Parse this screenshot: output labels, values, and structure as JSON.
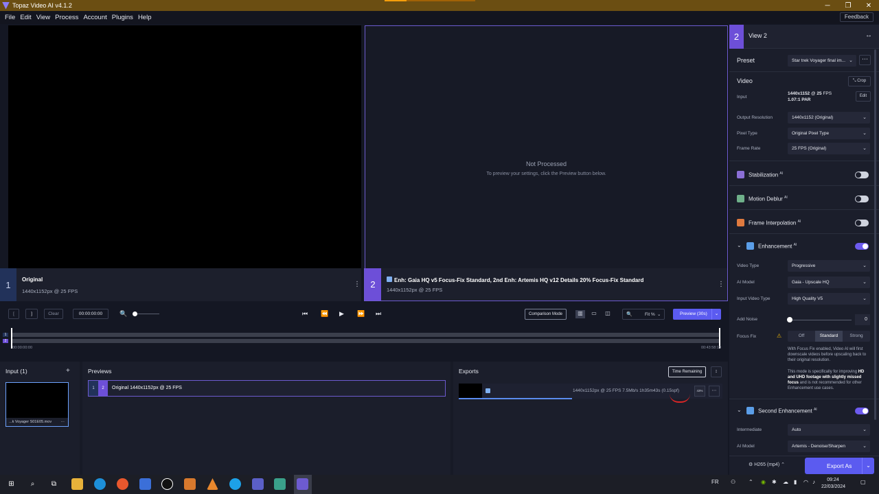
{
  "window": {
    "title": "Topaz Video AI  v4.1.2",
    "controls": [
      "─",
      "❐",
      "✕"
    ]
  },
  "menu": [
    "File",
    "Edit",
    "View",
    "Process",
    "Account",
    "Plugins",
    "Help"
  ],
  "feedback_label": "Feedback",
  "viewer2": {
    "status": "Not Processed",
    "hint": "To preview your settings, click the Preview button below."
  },
  "view1_info": {
    "number": "1",
    "name": "Original",
    "details": "1440x1152px @ 25 FPS"
  },
  "view2_info": {
    "number": "2",
    "name": "Enh: Gaia HQ v5 Focus-Fix Standard, 2nd Enh: Artemis HQ v12 Details 20% Focus-Fix Standard",
    "details": "1440x1152px @ 25 FPS"
  },
  "controls": {
    "in_marker": "[",
    "out_marker": "]",
    "clear_label": "Clear",
    "timecode": "00:00:00:00",
    "comparison_label": "Comparison Mode",
    "zoom_label": "Fit %",
    "preview_label": "Preview (30s)"
  },
  "timeline": {
    "start": "00:00:00:00",
    "end": "00:43:58:19",
    "track_badges": [
      "1",
      "2"
    ]
  },
  "inputs": {
    "title": "Input (1)",
    "add": "+",
    "item_caption": "...k Voyager S01E05.mov",
    "item_menu": "⋯"
  },
  "previews": {
    "title": "Previews",
    "row": {
      "n1": "1",
      "n2": "2",
      "label": "Original   1440x1152px @ 25 FPS"
    }
  },
  "exports": {
    "title": "Exports",
    "time_remaining_label": "Time Remaining",
    "sort_icon": "↕",
    "row_info": "1440x1152px @ 25 FPS  7.5Mb/s     1h35m43s (0.15spf)",
    "percent": "43%",
    "more": "⋯",
    "progress": 0.43
  },
  "sidebar": {
    "view_number": "2",
    "view_title": "View 2",
    "preset_label": "Preset",
    "preset_value": "Star trek Voyager final im...",
    "video_label": "Video",
    "crop_label": "Crop",
    "input_label": "Input",
    "input_res": "1440x1152",
    "input_at": " @ ",
    "input_fps": "25",
    "input_fps_unit": " FPS",
    "input_par": "1.07:1 PAR",
    "edit_label": "Edit",
    "output_res_label": "Output Resolution",
    "output_res_value": "1440x1152 (Original)",
    "pixel_type_label": "Pixel Type",
    "pixel_type_value": "Original Pixel Type",
    "frame_rate_label": "Frame Rate",
    "frame_rate_value": "25 FPS (Original)",
    "stabilization": "Stabilization",
    "motion_deblur": "Motion Deblur",
    "frame_interp": "Frame Interpolation",
    "enhancement": "Enhancement",
    "ai_sup": "AI",
    "video_type_label": "Video Type",
    "video_type_value": "Progressive",
    "ai_model_label": "AI Model",
    "ai_model_value": "Gaia - Upscale HQ",
    "input_video_type_label": "Input Video Type",
    "input_video_type_value": "High Quality V5",
    "add_noise_label": "Add Noise",
    "add_noise_value": "0",
    "focus_fix_label": "Focus Fix",
    "focus_options": [
      "Off",
      "Standard",
      "Strong"
    ],
    "focus_note": "With Focus Fix enabled, Video AI will first downscale videos before upscaling back to their original resolution.",
    "note2_a": "This mode is specifically for improving ",
    "note2_b": "HD and UHD footage with slightly missed focus",
    "note2_c": " and is not recommended for other Enhancement use cases.",
    "second_enh": "Second Enhancement",
    "intermediate_label": "Intermediate",
    "intermediate_value": "Auto",
    "ai_model2_label": "AI Model",
    "ai_model2_value": "Artemis - Denoise/Sharpen",
    "codec": "H265 (mp4)",
    "export_label": "Export As"
  },
  "taskbar": {
    "lang": "FR",
    "time": "09:24",
    "date": "22/03/2024"
  },
  "colors": {
    "accent": "#5b5bf0",
    "view2": "#6d4fd8",
    "view1": "#22325a",
    "titlebar": "#6b4e12"
  }
}
